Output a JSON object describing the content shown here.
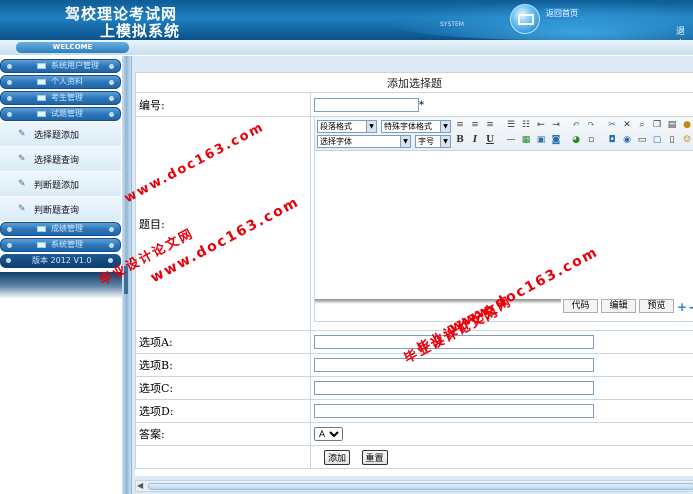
{
  "header": {
    "title_line1": "驾校理论考试网",
    "title_line2": "上模拟系统",
    "system_label": "SYSTEM",
    "home_label": "返回首页",
    "logout_label": "退出",
    "mail_icon": "envelope-icon"
  },
  "welcome_label": "WELCOME",
  "sidebar": {
    "menus": [
      {
        "label": "系统用户管理"
      },
      {
        "label": "个人资料"
      },
      {
        "label": "考生管理"
      },
      {
        "label": "试题管理"
      }
    ],
    "subitems": [
      {
        "label": "选择题添加"
      },
      {
        "label": "选择题查询"
      },
      {
        "label": "判断题添加"
      },
      {
        "label": "判断题查询"
      }
    ],
    "menus_after": [
      {
        "label": "成绩管理"
      },
      {
        "label": "系统管理"
      }
    ],
    "version": "版本 2012 V1.0"
  },
  "form": {
    "caption": "添加选择题",
    "number_label": "编号:",
    "title_label": "题目:",
    "option_a_label": "选项A:",
    "option_b_label": "选项B:",
    "option_c_label": "选项C:",
    "option_d_label": "选项D:",
    "answer_label": "答案:",
    "answer_value": "A",
    "required_mark": "*",
    "add_button": "添加",
    "reset_button": "重置"
  },
  "editor": {
    "paragraph_format": "段落格式",
    "special_format": "特殊字体格式",
    "font_select": "选择字体",
    "font_size": "字号",
    "tab_code": "代码",
    "tab_edit": "编辑",
    "tab_preview": "预览",
    "bold": "B",
    "italic": "I",
    "underline": "U",
    "zoom_in": "+",
    "zoom_out": "-"
  },
  "watermarks": {
    "site1": "www.doc163.com",
    "text1": "毕业设计论文网",
    "site2": "www.doc163.com",
    "text2": "毕业设计论文网",
    "site3": "www.doc163.com",
    "text3": "毕业设计论文网"
  },
  "colors": {
    "header_blue": "#0d5c95",
    "menu_blue": "#2a75b8",
    "watermark_red": "#e8000a"
  }
}
